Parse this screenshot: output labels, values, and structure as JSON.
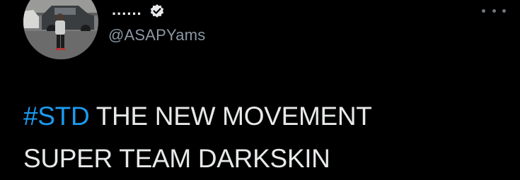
{
  "tweet": {
    "display_name": "......",
    "handle": "@ASAPYams",
    "hashtag": "#STD",
    "text_line1": "THE NEW MOVEMENT",
    "text_line2": "SUPER TEAM DARKSKIN"
  },
  "icons": {
    "verified": "verified-badge-icon",
    "more": "more-options-icon"
  },
  "colors": {
    "background": "#000000",
    "text": "#e7e9ea",
    "secondary_text": "#8b98a5",
    "hashtag": "#1d9bf0"
  }
}
